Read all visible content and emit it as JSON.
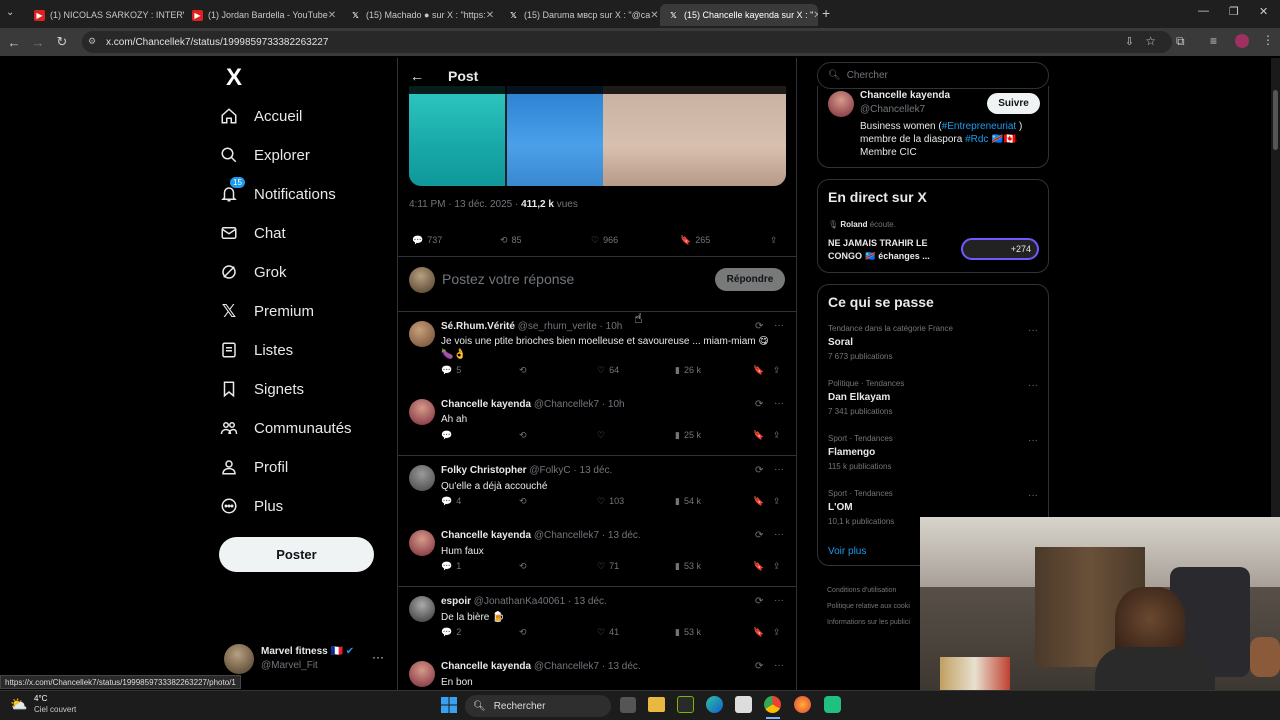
{
  "browser": {
    "tabs": [
      {
        "label": "(1) NICOLAS SARKOZY : INTERV",
        "icon": "youtube-icon"
      },
      {
        "label": "(1) Jordan Bardella - YouTube",
        "icon": "youtube-icon"
      },
      {
        "label": "(15) Machado ● sur X : \"https:",
        "icon": "x-icon"
      },
      {
        "label": "(15) Daruma мвср sur X : \"@ca",
        "icon": "x-icon"
      },
      {
        "label": "(15) Chancelle kayenda sur X : \"",
        "icon": "x-icon",
        "active": true
      }
    ],
    "url": "x.com/Chancellek7/status/1999859733382263227",
    "status_url": "https://x.com/Chancellek7/status/1999859733382263227/photo/1"
  },
  "nav": {
    "logo": "X",
    "items": [
      {
        "label": "Accueil",
        "icon": "home-icon"
      },
      {
        "label": "Explorer",
        "icon": "search-icon"
      },
      {
        "label": "Notifications",
        "icon": "bell-icon",
        "badge": "15"
      },
      {
        "label": "Chat",
        "icon": "mail-icon"
      },
      {
        "label": "Grok",
        "icon": "grok-icon"
      },
      {
        "label": "Premium",
        "icon": "x-premium-icon"
      },
      {
        "label": "Listes",
        "icon": "list-icon"
      },
      {
        "label": "Signets",
        "icon": "bookmark-icon"
      },
      {
        "label": "Communautés",
        "icon": "communities-icon"
      },
      {
        "label": "Profil",
        "icon": "person-icon"
      },
      {
        "label": "Plus",
        "icon": "more-circle-icon"
      }
    ],
    "post_button": "Poster",
    "account": {
      "name": "Marvel fitness 🇫🇷",
      "handle": "@Marvel_Fit"
    }
  },
  "post": {
    "header_title": "Post",
    "time": "4:11 PM · 13 déc. 2025 · ",
    "views": "411,2 k",
    "views_label": " vues",
    "replies": "737",
    "reposts": "85",
    "likes": "966",
    "bookmarks": "265",
    "reply_placeholder": "Postez votre réponse",
    "reply_button": "Répondre"
  },
  "replies": [
    {
      "name": "Sé.Rhum.Vérité",
      "handle": "@se_rhum_verite · 10h",
      "text": "Je vois une ptite brioches bien moelleuse et savoureuse ... miam-miam 😋 🍆👌",
      "replies": "5",
      "reposts": "",
      "likes": "64",
      "views": "26 k"
    },
    {
      "name": "Chancelle kayenda",
      "handle": "@Chancellek7 · 10h",
      "text": "Ah ah",
      "replies": "",
      "reposts": "",
      "likes": "",
      "views": "25 k"
    },
    {
      "name": "Folky Christopher",
      "handle": "@FolkyC · 13 déc.",
      "text": "Qu'elle a déjà accouché",
      "replies": "4",
      "reposts": "",
      "likes": "103",
      "views": "54 k"
    },
    {
      "name": "Chancelle kayenda",
      "handle": "@Chancellek7 · 13 déc.",
      "text": "Hum faux",
      "replies": "1",
      "reposts": "",
      "likes": "71",
      "views": "53 k"
    },
    {
      "name": "espoir",
      "handle": "@JonathanKa40061 · 13 déc.",
      "text": "De la bière 🍺",
      "replies": "2",
      "reposts": "",
      "likes": "41",
      "views": "53 k"
    },
    {
      "name": "Chancelle kayenda",
      "handle": "@Chancellek7 · 13 déc.",
      "text": "En bon",
      "replies": "",
      "reposts": "",
      "likes": "",
      "views": ""
    }
  ],
  "right": {
    "search_placeholder": "Chercher",
    "profile": {
      "name": "Chancelle kayenda",
      "handle": "@Chancellek7",
      "follow": "Suivre",
      "bio_pre": "Business women (",
      "bio_tag1": "#Entrepreneuriat",
      "bio_mid": " ) membre de la diaspora ",
      "bio_tag2": "#Rdc",
      "bio_post": " 🇨🇩🇨🇦 Membre CIC"
    },
    "live": {
      "title": "En direct sur X",
      "host": "Roland",
      "host_suffix": " écoute.",
      "text": "NE JAMAIS TRAHIR LE CONGO 🇨🇩 échanges ...",
      "count": "+274"
    },
    "trends": {
      "title": "Ce qui se passe",
      "items": [
        {
          "category": "Tendance dans la catégorie France",
          "name": "Soral",
          "count": "7 673 publications"
        },
        {
          "category": "Politique · Tendances",
          "name": "Dan Elkayam",
          "count": "7 341 publications"
        },
        {
          "category": "Sport · Tendances",
          "name": "Flamengo",
          "count": "115 k publications"
        },
        {
          "category": "Sport · Tendances",
          "name": "L'OM",
          "count": "10,1 k publications"
        }
      ],
      "see_more": "Voir plus"
    },
    "footer": [
      "Conditions d'utilisation",
      "Politique relative aux cooki",
      "Informations sur les publici"
    ]
  },
  "taskbar": {
    "temp": "4°C",
    "weather": "Ciel couvert",
    "search": "Rechercher"
  },
  "colors": {
    "accent": "#1d9bf0",
    "background": "#000000",
    "border": "#2f3336",
    "muted": "#71767b"
  }
}
